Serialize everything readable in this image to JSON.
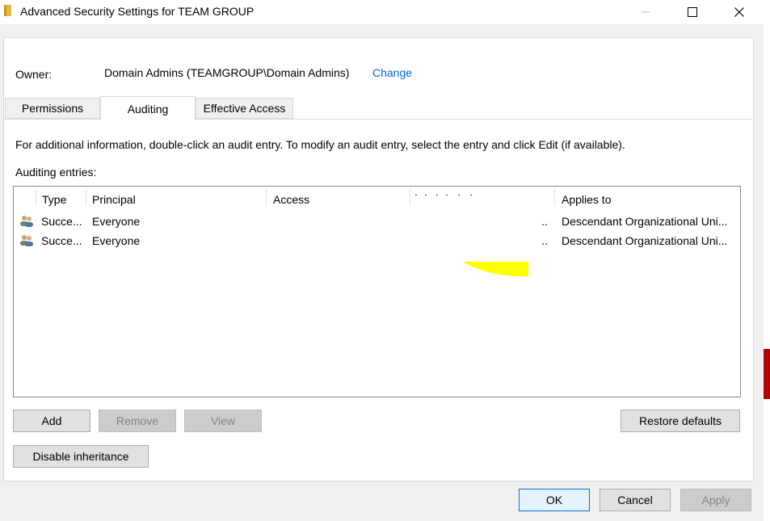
{
  "window": {
    "title": "Advanced Security Settings for TEAM GROUP",
    "minimize_glyph": "—",
    "maximize_glyph": "☐",
    "close_glyph": "✕"
  },
  "owner": {
    "label": "Owner:",
    "value": "Domain Admins (TEAMGROUP\\Domain Admins)",
    "change_link": "Change"
  },
  "tabs": [
    {
      "label": "Permissions",
      "active": false
    },
    {
      "label": "Auditing",
      "active": true
    },
    {
      "label": "Effective Access",
      "active": false
    }
  ],
  "auditing": {
    "info": "For additional information, double-click an audit entry. To modify an audit entry, select the entry and click Edit (if available).",
    "entries_label": "Auditing entries:",
    "columns": [
      "Type",
      "Principal",
      "Access",
      "",
      "Applies to"
    ],
    "rows": [
      {
        "type": "Succe...",
        "principal": "Everyone",
        "access": "",
        "inherited": "..",
        "applies_to": "Descendant Organizational Uni...",
        "icon": "users-icon"
      },
      {
        "type": "Succe...",
        "principal": "Everyone",
        "access": "",
        "inherited": "..",
        "applies_to": "Descendant Organizational Uni...",
        "icon": "users-icon"
      }
    ]
  },
  "buttons": {
    "add": "Add",
    "remove": "Remove",
    "view": "View",
    "restore_defaults": "Restore defaults",
    "disable_inheritance": "Disable inheritance",
    "ok": "OK",
    "cancel": "Cancel",
    "apply": "Apply"
  },
  "colors": {
    "link": "#0066cc",
    "highlight": "#ffff00",
    "accent": "#0078d7"
  }
}
